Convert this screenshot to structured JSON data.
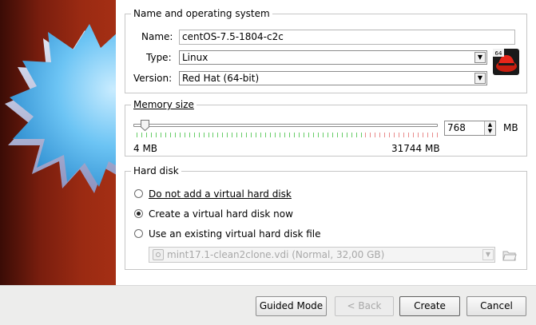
{
  "name_os": {
    "legend": "Name and operating system",
    "name_label": "Name:",
    "name_value": "centOS-7.5-1804-c2c",
    "type_label": "Type:",
    "type_value": "Linux",
    "version_label": "Version:",
    "version_value": "Red Hat (64-bit)",
    "os_icon": "redhat-64bit-icon",
    "os_icon_badge": "64"
  },
  "memory": {
    "legend": "Memory size",
    "value": "768",
    "unit": "MB",
    "min_label": "4 MB",
    "max_label": "31744 MB",
    "min_mb": 4,
    "max_mb": 31744,
    "current_mb": 768
  },
  "hard_disk": {
    "legend": "Hard disk",
    "options": [
      {
        "label": "Do not add a virtual hard disk",
        "checked": false
      },
      {
        "label": "Create a virtual hard disk now",
        "checked": true
      },
      {
        "label": "Use an existing virtual hard disk file",
        "checked": false
      }
    ],
    "existing_file": "mint17.1-clean2clone.vdi (Normal, 32,00 GB)"
  },
  "footer": {
    "guided_mode": "Guided Mode",
    "back": "< Back",
    "create": "Create",
    "cancel": "Cancel"
  },
  "colors": {
    "side_panel": "#9a2a12",
    "star": "#5bb8f0",
    "ticks_green": "#66cc66",
    "ticks_red": "#e88a8a"
  }
}
